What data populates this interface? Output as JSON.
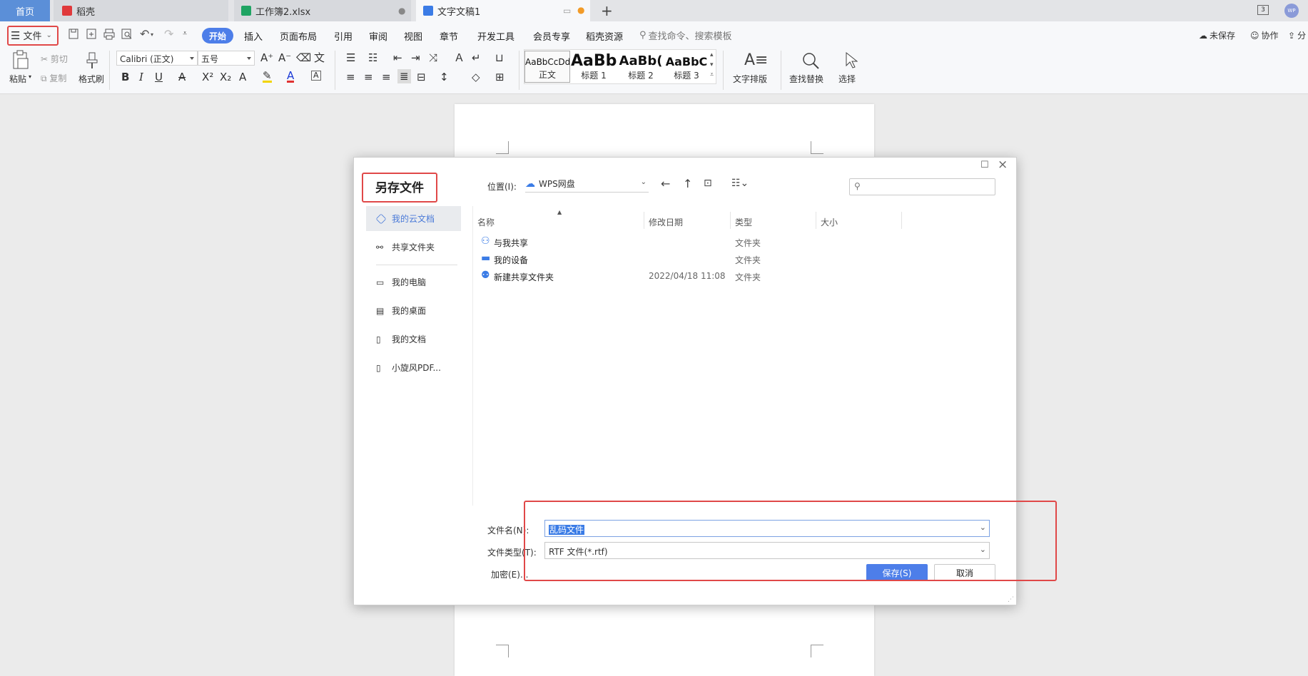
{
  "tabs": {
    "home": "首页",
    "daoke": "稻壳",
    "xlsx": "工作簿2.xlsx",
    "doc": "文字文稿1",
    "new_tab": "+"
  },
  "top_right": {
    "window_count": "3",
    "avatar": "WP"
  },
  "menu": {
    "file": "文件",
    "start": "开始",
    "insert": "插入",
    "layout": "页面布局",
    "ref": "引用",
    "review": "审阅",
    "view": "视图",
    "chapter": "章节",
    "dev": "开发工具",
    "member": "会员专享",
    "resource": "稻壳资源",
    "search_placeholder": "查找命令、搜索模板",
    "unsaved": "未保存",
    "collab": "协作",
    "share": "分"
  },
  "ribbon": {
    "paste": "粘贴",
    "cut": "剪切",
    "copy": "复制",
    "format_painter": "格式刷",
    "font_name": "Calibri (正文)",
    "font_size": "五号",
    "styles": [
      {
        "sample": "AaBbCcDd",
        "label": "正文"
      },
      {
        "sample": "AaBb",
        "label": "标题 1"
      },
      {
        "sample": "AaBb(",
        "label": "标题 2"
      },
      {
        "sample": "AaBbC",
        "label": "标题 3"
      }
    ],
    "text_layout": "文字排版",
    "find_replace": "查找替换",
    "select": "选择"
  },
  "dialog": {
    "title": "另存文件",
    "location_label": "位置(I):",
    "location_value": "WPS网盘",
    "sidebar": [
      "我的云文档",
      "共享文件夹",
      "我的电脑",
      "我的桌面",
      "我的文档",
      "小旋风PDF..."
    ],
    "columns": {
      "name": "名称",
      "date": "修改日期",
      "type": "类型",
      "size": "大小"
    },
    "rows": [
      {
        "name": "与我共享",
        "date": "",
        "type": "文件夹"
      },
      {
        "name": "我的设备",
        "date": "",
        "type": "文件夹"
      },
      {
        "name": "新建共享文件夹",
        "date": "2022/04/18 11:08",
        "type": "文件夹"
      }
    ],
    "filename_label": "文件名(N):",
    "filename_value": "乱码文件",
    "filetype_label": "文件类型(T):",
    "filetype_value": "RTF 文件(*.rtf)",
    "encrypt": "加密(E)...",
    "save": "保存(S)",
    "cancel": "取消"
  },
  "colors": {
    "accent": "#4d7ee9",
    "highlight": "#e04848"
  }
}
